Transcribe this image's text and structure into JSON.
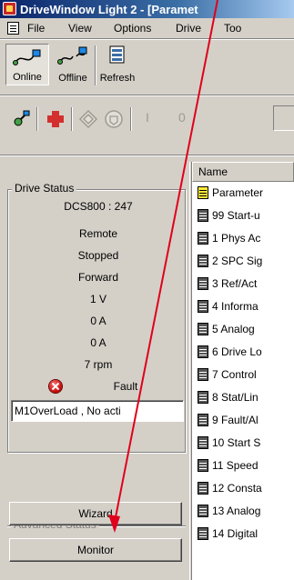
{
  "window": {
    "title": "DriveWindow Light 2 - [Paramet"
  },
  "menu": [
    "File",
    "View",
    "Options",
    "Drive",
    "Too"
  ],
  "toolbar": {
    "online_label": "Online",
    "offline_label": "Offline",
    "refresh_label": "Refresh",
    "secondary": [
      "I",
      "0"
    ]
  },
  "drive_status": {
    "title": "Drive Status",
    "lines": [
      "DCS800 : 247",
      "Remote",
      "Stopped",
      "Forward",
      "1 V",
      "0 A",
      "0 A",
      "7 rpm"
    ],
    "fault_label": "Fault",
    "fault_message": "M1OverLoad  , No acti"
  },
  "advanced_status": {
    "title": "Advanced Status"
  },
  "buttons": {
    "wizard": "Wizard",
    "monitor": "Monitor"
  },
  "tree": {
    "header": "Name",
    "items": [
      {
        "label": "Parameter",
        "icon": "yellow-doc-icon"
      },
      {
        "label": "99  Start-u",
        "icon": "doc-icon"
      },
      {
        "label": "1  Phys Ac",
        "icon": "doc-icon"
      },
      {
        "label": "2  SPC Sig",
        "icon": "doc-icon"
      },
      {
        "label": "3  Ref/Act",
        "icon": "doc-icon"
      },
      {
        "label": "4  Informa",
        "icon": "doc-icon"
      },
      {
        "label": "5  Analog",
        "icon": "doc-icon"
      },
      {
        "label": "6  Drive Lo",
        "icon": "doc-icon"
      },
      {
        "label": "7  Control",
        "icon": "doc-icon"
      },
      {
        "label": "8  Stat/Lin",
        "icon": "doc-icon"
      },
      {
        "label": "9  Fault/Al",
        "icon": "doc-icon"
      },
      {
        "label": "10  Start S",
        "icon": "doc-icon"
      },
      {
        "label": "11  Speed",
        "icon": "doc-icon"
      },
      {
        "label": "12  Consta",
        "icon": "doc-icon"
      },
      {
        "label": "13  Analog",
        "icon": "doc-icon"
      },
      {
        "label": "14  Digital",
        "icon": "doc-icon"
      }
    ]
  },
  "colors": {
    "title_bar": "#0a246a",
    "annotation_arrow": "#e0001b",
    "fault": "#c00000"
  }
}
